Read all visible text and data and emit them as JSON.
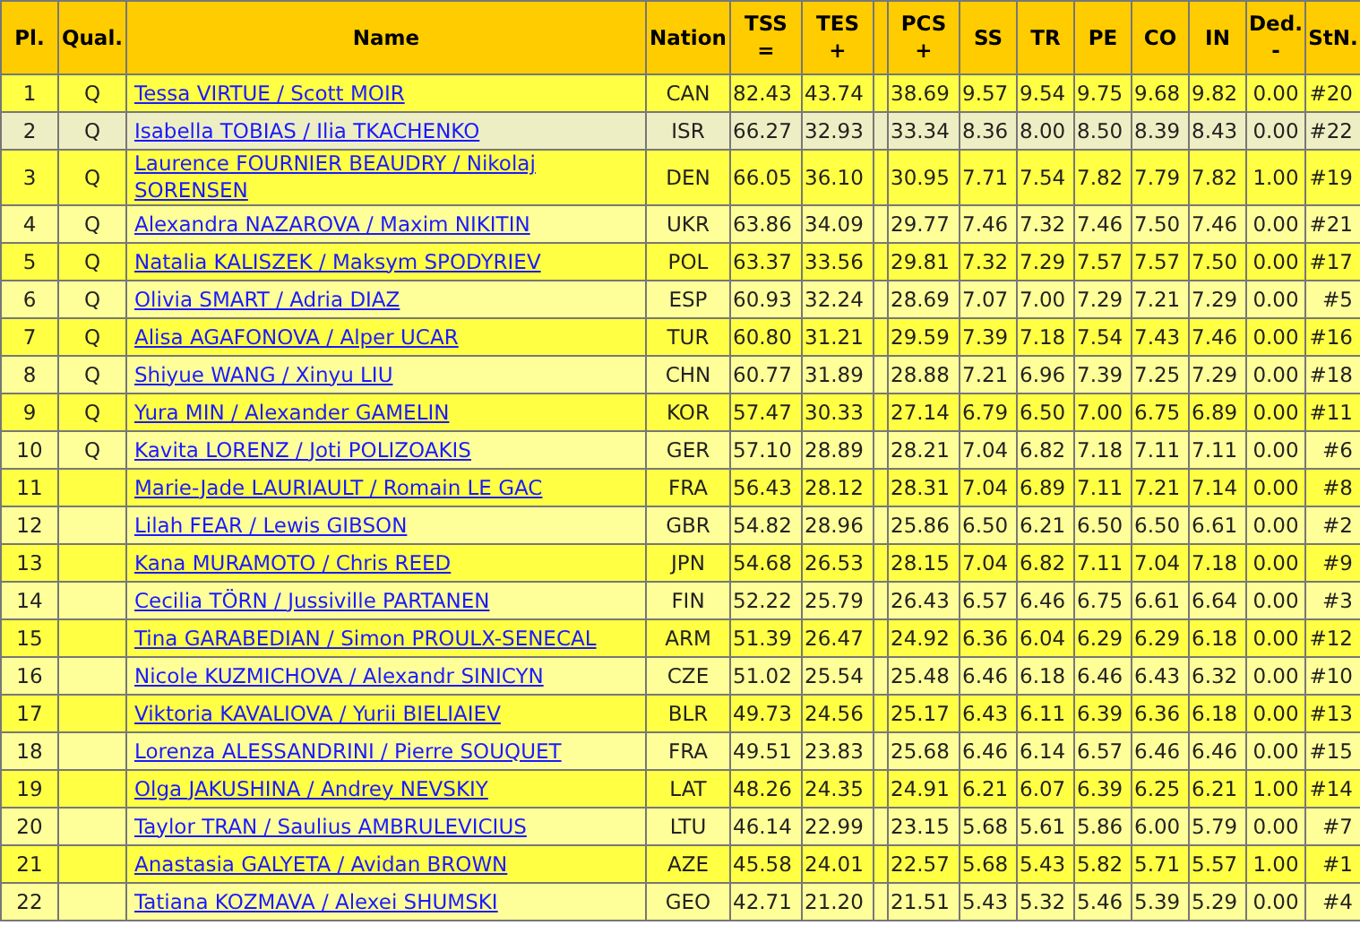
{
  "table": {
    "columns": [
      {
        "label": "Pl."
      },
      {
        "label": "Qual."
      },
      {
        "label": "Name"
      },
      {
        "label": "Nation"
      },
      {
        "label": "TSS",
        "sub": "="
      },
      {
        "label": "TES",
        "sub": "+"
      },
      {},
      {
        "label": "PCS",
        "sub": "+"
      },
      {
        "label": "SS"
      },
      {
        "label": "TR"
      },
      {
        "label": "PE"
      },
      {
        "label": "CO"
      },
      {
        "label": "IN"
      },
      {
        "label": "Ded.",
        "sub": "-"
      },
      {
        "label": "StN."
      }
    ],
    "rows": [
      {
        "pl": "1",
        "qual": "Q",
        "name": "Tessa VIRTUE / Scott MOIR",
        "nation": "CAN",
        "scores": [
          "82.43",
          "43.74",
          "38.69",
          "9.57",
          "9.54",
          "9.75",
          "9.68",
          "9.82",
          "0.00"
        ],
        "stn": "#20",
        "selected": false
      },
      {
        "pl": "2",
        "qual": "Q",
        "name": "Isabella TOBIAS / Ilia TKACHENKO",
        "nation": "ISR",
        "scores": [
          "66.27",
          "32.93",
          "33.34",
          "8.36",
          "8.00",
          "8.50",
          "8.39",
          "8.43",
          "0.00"
        ],
        "stn": "#22",
        "selected": true
      },
      {
        "pl": "3",
        "qual": "Q",
        "name": "Laurence FOURNIER BEAUDRY / Nikolaj SORENSEN",
        "nation": "DEN",
        "scores": [
          "66.05",
          "36.10",
          "30.95",
          "7.71",
          "7.54",
          "7.82",
          "7.79",
          "7.82",
          "1.00"
        ],
        "stn": "#19",
        "selected": false
      },
      {
        "pl": "4",
        "qual": "Q",
        "name": "Alexandra NAZAROVA / Maxim NIKITIN",
        "nation": "UKR",
        "scores": [
          "63.86",
          "34.09",
          "29.77",
          "7.46",
          "7.32",
          "7.46",
          "7.50",
          "7.46",
          "0.00"
        ],
        "stn": "#21",
        "selected": false
      },
      {
        "pl": "5",
        "qual": "Q",
        "name": "Natalia KALISZEK / Maksym SPODYRIEV",
        "nation": "POL",
        "scores": [
          "63.37",
          "33.56",
          "29.81",
          "7.32",
          "7.29",
          "7.57",
          "7.57",
          "7.50",
          "0.00"
        ],
        "stn": "#17",
        "selected": false
      },
      {
        "pl": "6",
        "qual": "Q",
        "name": "Olivia SMART / Adria DIAZ",
        "nation": "ESP",
        "scores": [
          "60.93",
          "32.24",
          "28.69",
          "7.07",
          "7.00",
          "7.29",
          "7.21",
          "7.29",
          "0.00"
        ],
        "stn": "#5",
        "selected": false
      },
      {
        "pl": "7",
        "qual": "Q",
        "name": "Alisa AGAFONOVA / Alper UCAR",
        "nation": "TUR",
        "scores": [
          "60.80",
          "31.21",
          "29.59",
          "7.39",
          "7.18",
          "7.54",
          "7.43",
          "7.46",
          "0.00"
        ],
        "stn": "#16",
        "selected": false
      },
      {
        "pl": "8",
        "qual": "Q",
        "name": "Shiyue WANG / Xinyu LIU",
        "nation": "CHN",
        "scores": [
          "60.77",
          "31.89",
          "28.88",
          "7.21",
          "6.96",
          "7.39",
          "7.25",
          "7.29",
          "0.00"
        ],
        "stn": "#18",
        "selected": false
      },
      {
        "pl": "9",
        "qual": "Q",
        "name": "Yura MIN / Alexander GAMELIN",
        "nation": "KOR",
        "scores": [
          "57.47",
          "30.33",
          "27.14",
          "6.79",
          "6.50",
          "7.00",
          "6.75",
          "6.89",
          "0.00"
        ],
        "stn": "#11",
        "selected": false
      },
      {
        "pl": "10",
        "qual": "Q",
        "name": "Kavita LORENZ / Joti POLIZOAKIS",
        "nation": "GER",
        "scores": [
          "57.10",
          "28.89",
          "28.21",
          "7.04",
          "6.82",
          "7.18",
          "7.11",
          "7.11",
          "0.00"
        ],
        "stn": "#6",
        "selected": false
      },
      {
        "pl": "11",
        "name": "Marie-Jade LAURIAULT / Romain LE GAC",
        "nation": "FRA",
        "scores": [
          "56.43",
          "28.12",
          "28.31",
          "7.04",
          "6.89",
          "7.11",
          "7.21",
          "7.14",
          "0.00"
        ],
        "stn": "#8",
        "selected": false
      },
      {
        "pl": "12",
        "name": "Lilah FEAR / Lewis GIBSON",
        "nation": "GBR",
        "scores": [
          "54.82",
          "28.96",
          "25.86",
          "6.50",
          "6.21",
          "6.50",
          "6.50",
          "6.61",
          "0.00"
        ],
        "stn": "#2",
        "selected": false
      },
      {
        "pl": "13",
        "name": "Kana MURAMOTO / Chris REED",
        "nation": "JPN",
        "scores": [
          "54.68",
          "26.53",
          "28.15",
          "7.04",
          "6.82",
          "7.11",
          "7.04",
          "7.18",
          "0.00"
        ],
        "stn": "#9",
        "selected": false
      },
      {
        "pl": "14",
        "name": "Cecilia TÖRN / Jussiville PARTANEN",
        "nation": "FIN",
        "scores": [
          "52.22",
          "25.79",
          "26.43",
          "6.57",
          "6.46",
          "6.75",
          "6.61",
          "6.64",
          "0.00"
        ],
        "stn": "#3",
        "selected": false
      },
      {
        "pl": "15",
        "name": "Tina GARABEDIAN / Simon PROULX-SENECAL",
        "nation": "ARM",
        "scores": [
          "51.39",
          "26.47",
          "24.92",
          "6.36",
          "6.04",
          "6.29",
          "6.29",
          "6.18",
          "0.00"
        ],
        "stn": "#12",
        "selected": false
      },
      {
        "pl": "16",
        "name": "Nicole KUZMICHOVA / Alexandr SINICYN",
        "nation": "CZE",
        "scores": [
          "51.02",
          "25.54",
          "25.48",
          "6.46",
          "6.18",
          "6.46",
          "6.43",
          "6.32",
          "0.00"
        ],
        "stn": "#10",
        "selected": false
      },
      {
        "pl": "17",
        "name": "Viktoria KAVALIOVA / Yurii BIELIAIEV",
        "nation": "BLR",
        "scores": [
          "49.73",
          "24.56",
          "25.17",
          "6.43",
          "6.11",
          "6.39",
          "6.36",
          "6.18",
          "0.00"
        ],
        "stn": "#13",
        "selected": false
      },
      {
        "pl": "18",
        "name": "Lorenza ALESSANDRINI / Pierre SOUQUET",
        "nation": "FRA",
        "scores": [
          "49.51",
          "23.83",
          "25.68",
          "6.46",
          "6.14",
          "6.57",
          "6.46",
          "6.46",
          "0.00"
        ],
        "stn": "#15",
        "selected": false
      },
      {
        "pl": "19",
        "name": "Olga JAKUSHINA / Andrey NEVSKIY",
        "nation": "LAT",
        "scores": [
          "48.26",
          "24.35",
          "24.91",
          "6.21",
          "6.07",
          "6.39",
          "6.25",
          "6.21",
          "1.00"
        ],
        "stn": "#14",
        "selected": false
      },
      {
        "pl": "20",
        "name": "Taylor TRAN / Saulius AMBRULEVICIUS",
        "nation": "LTU",
        "scores": [
          "46.14",
          "22.99",
          "23.15",
          "5.68",
          "5.61",
          "5.86",
          "6.00",
          "5.79",
          "0.00"
        ],
        "stn": "#7",
        "selected": false
      },
      {
        "pl": "21",
        "name": "Anastasia GALYETA / Avidan BROWN",
        "nation": "AZE",
        "scores": [
          "45.58",
          "24.01",
          "22.57",
          "5.68",
          "5.43",
          "5.82",
          "5.71",
          "5.57",
          "1.00"
        ],
        "stn": "#1",
        "selected": false
      },
      {
        "pl": "22",
        "name": "Tatiana KOZMAVA / Alexei SHUMSKI",
        "nation": "GEO",
        "scores": [
          "42.71",
          "21.20",
          "21.51",
          "5.43",
          "5.32",
          "5.46",
          "5.39",
          "5.29",
          "0.00"
        ],
        "stn": "#4",
        "selected": false
      }
    ]
  }
}
